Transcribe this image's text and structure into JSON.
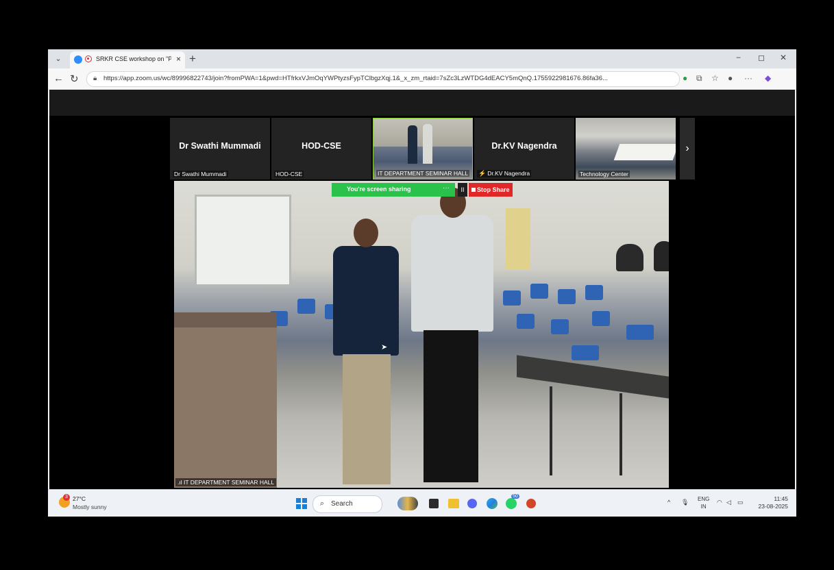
{
  "browser": {
    "tab_title": "SRKR CSE workshop on \"Prod",
    "tab_close": "×",
    "new_tab": "+",
    "url": "https://app.zoom.us/wc/89996822743/join?fromPWA=1&pwd=HTfrkxVJmOqYWPtyzsFypTClbgzXqj.1&_x_zm_rtaid=7sZc3LzWTDG4dEACY5mQnQ.1755922981676.86fa36...",
    "window_controls": [
      "−",
      "◻",
      "✕"
    ]
  },
  "zoom": {
    "participants": [
      {
        "name": "Dr Swathi Mummadi",
        "label": "Dr Swathi Mummadi",
        "muted": false
      },
      {
        "name": "HOD-CSE",
        "label": "HOD-CSE",
        "muted": false
      },
      {
        "name": "",
        "label": "IT DEPARTMENT SEMINAR HALL",
        "muted": false
      },
      {
        "name": "Dr.KV Nagendra",
        "label": "Dr.KV Nagendra",
        "muted": true
      },
      {
        "name": "",
        "label": "Technology Center",
        "muted": false
      }
    ],
    "next_icon": "›",
    "main_label": "IT DEPARTMENT SEMINAR HALL",
    "share_text": "You're screen sharing",
    "share_more": "···",
    "pause_label": "II",
    "stop_label": "Stop Share"
  },
  "taskbar": {
    "weather_badge": "3",
    "temp": "27°C",
    "condition": "Mostly sunny",
    "search_label": "Search",
    "whatsapp_badge": "50",
    "lang_top": "ENG",
    "lang_bottom": "IN",
    "time": "11:45",
    "date": "23-08-2025"
  },
  "colors": {
    "share_green": "#2bc24c",
    "stop_red": "#e02828",
    "zoom_blue": "#2d8cff",
    "chair_blue": "#2f63b3"
  }
}
